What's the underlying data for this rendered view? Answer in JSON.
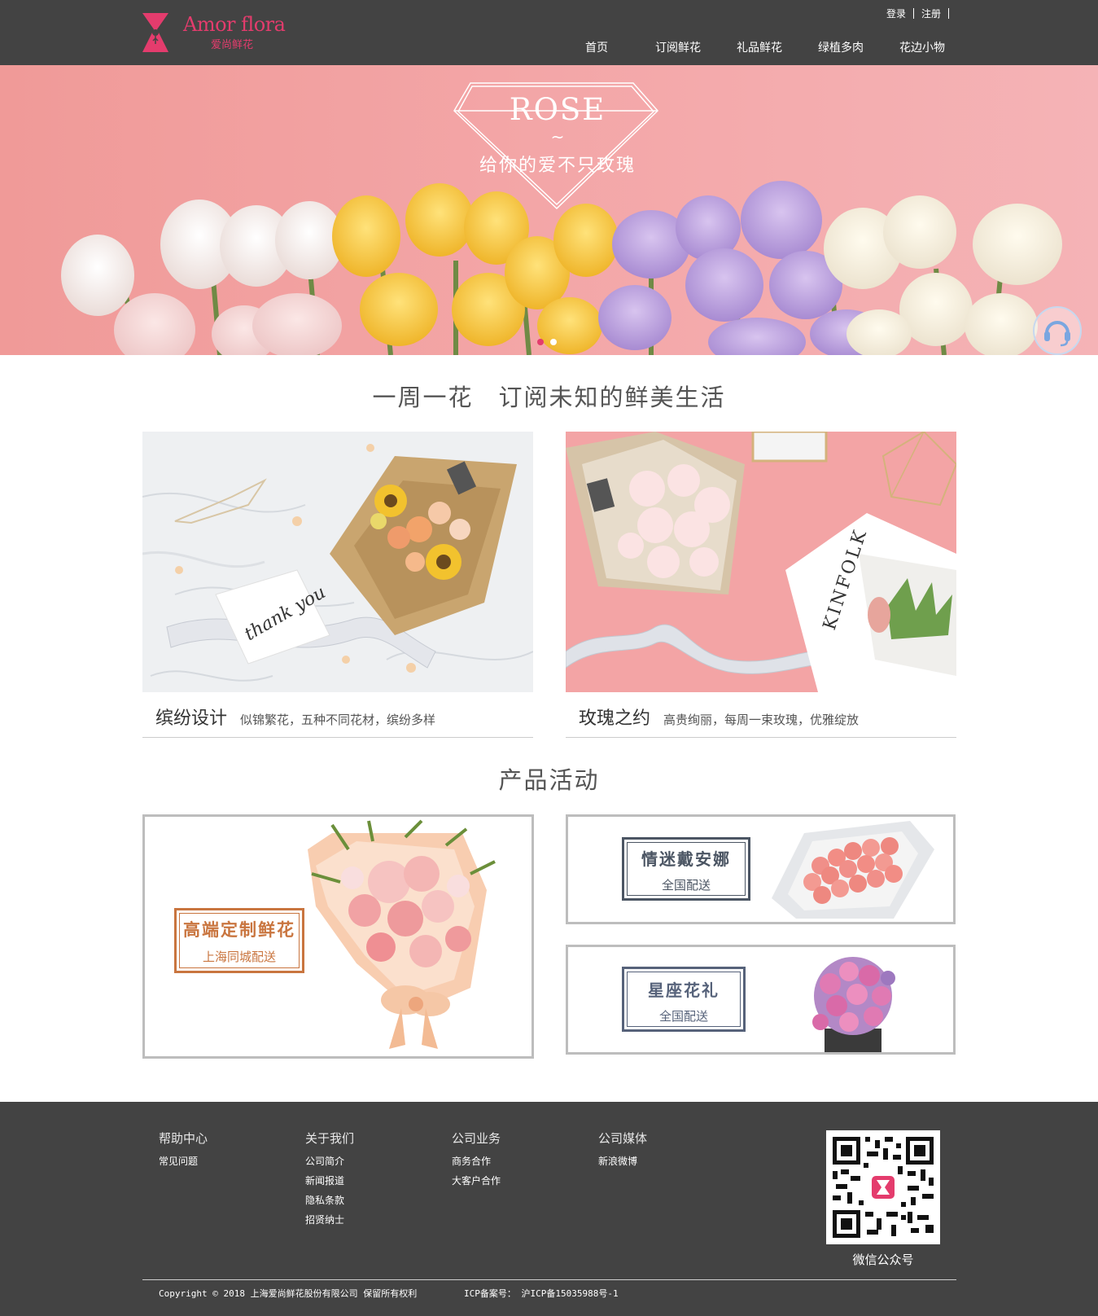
{
  "header": {
    "logo_en": "Amor flora",
    "logo_cn": "爱尚鲜花",
    "login": "登录",
    "register": "注册",
    "nav": [
      "首页",
      "订阅鲜花",
      "礼品鲜花",
      "绿植多肉",
      "花边小物"
    ]
  },
  "banner": {
    "title": "ROSE",
    "tilde": "~",
    "subtitle": "给你的爱不只玫瑰",
    "slides": 2,
    "active_slide": 1
  },
  "subscription": {
    "heading": "一周一花　订阅未知的鲜美生活",
    "cards": [
      {
        "title": "缤纷设计",
        "desc": "似锦繁花，五种不同花材，缤纷多样",
        "image_text": "thank you"
      },
      {
        "title": "玫瑰之约",
        "desc": "高贵绚丽，每周一束玫瑰，优雅绽放",
        "image_text": "KINFOLK"
      }
    ]
  },
  "promotions": {
    "heading": "产品活动",
    "items": [
      {
        "title": "高端定制鲜花",
        "sub": "上海同城配送",
        "color": "#c9753f"
      },
      {
        "title": "情迷戴安娜",
        "sub": "全国配送",
        "color": "#4b5563"
      },
      {
        "title": "星座花礼",
        "sub": "全国配送",
        "color": "#56627a"
      }
    ]
  },
  "footer": {
    "columns": [
      {
        "title": "帮助中心",
        "links": [
          "常见问题"
        ]
      },
      {
        "title": "关于我们",
        "links": [
          "公司简介",
          "新闻报道",
          "隐私条款",
          "招贤纳士"
        ]
      },
      {
        "title": "公司业务",
        "links": [
          "商务合作",
          "大客户合作"
        ]
      },
      {
        "title": "公司媒体",
        "links": [
          "新浪微博"
        ]
      }
    ],
    "qr_label": "微信公众号",
    "copyright": "Copyright © 2018 上海爱尚鲜花股份有限公司 保留所有权利",
    "icp": "ICP备案号： 沪ICP备15035988号-1"
  },
  "colors": {
    "brand": "#e43c6d",
    "header_bg": "#434343",
    "banner_bg": "#f3a5a6"
  }
}
